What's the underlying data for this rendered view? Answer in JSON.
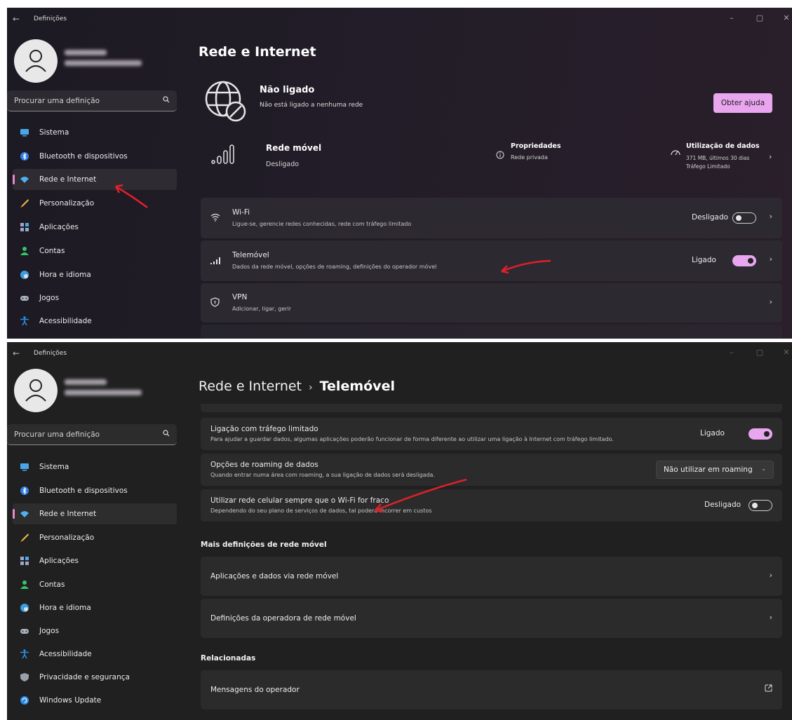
{
  "window": {
    "app_title": "Definições",
    "back_icon": "arrow-left-icon",
    "controls": [
      "minimize-icon",
      "restore-icon",
      "close-icon"
    ]
  },
  "search": {
    "placeholder": "Procurar uma definição",
    "icon": "search-icon"
  },
  "nav": {
    "items": [
      {
        "label": "Sistema",
        "icon": "monitor-icon"
      },
      {
        "label": "Bluetooth e dispositivos",
        "icon": "bluetooth-icon"
      },
      {
        "label": "Rede e Internet",
        "icon": "wifi-icon"
      },
      {
        "label": "Personalização",
        "icon": "brush-icon"
      },
      {
        "label": "Aplicações",
        "icon": "apps-icon"
      },
      {
        "label": "Contas",
        "icon": "person-icon"
      },
      {
        "label": "Hora e idioma",
        "icon": "globe-clock-icon"
      },
      {
        "label": "Jogos",
        "icon": "gamepad-icon"
      },
      {
        "label": "Acessibilidade",
        "icon": "accessibility-icon"
      },
      {
        "label": "Privacidade e segurança",
        "icon": "shield-icon"
      },
      {
        "label": "Windows Update",
        "icon": "update-icon"
      }
    ]
  },
  "top": {
    "page_title": "Rede e Internet",
    "status": {
      "title": "Não ligado",
      "subtitle": "Não está ligado a nenhuma rede",
      "help_button": "Obter ajuda"
    },
    "mobile": {
      "title": "Rede móvel",
      "subtitle": "Desligado"
    },
    "properties": {
      "title": "Propriedades",
      "subtitle": "Rede privada"
    },
    "data_usage": {
      "title": "Utilização de dados",
      "line1": "371 MB, últimos 30 dias",
      "line2": "Tráfego Limitado"
    },
    "rows": [
      {
        "title": "Wi-Fi",
        "subtitle": "Ligue-se, gerencie redes conhecidas, rede com tráfego limitado",
        "state": "Desligado",
        "on": false
      },
      {
        "title": "Telemóvel",
        "subtitle": "Dados da rede móvel, opções de roaming, definições do operador móvel",
        "state": "Ligado",
        "on": true
      },
      {
        "title": "VPN",
        "subtitle": "Adicionar, ligar, gerir"
      }
    ]
  },
  "bottom": {
    "breadcrumb": {
      "parent": "Rede e Internet",
      "separator": "›",
      "current": "Telemóvel"
    },
    "rows": [
      {
        "title": "Ligação com tráfego limitado",
        "subtitle": "Para ajudar a guardar dados, algumas aplicações poderão funcionar de forma diferente ao utilizar uma ligação à Internet com tráfego limitado.",
        "state": "Ligado",
        "on": true
      },
      {
        "title": "Opções de roaming de dados",
        "subtitle": "Quando entrar numa área com roaming, a sua ligação de dados será desligada.",
        "dropdown": "Não utilizar em roaming"
      },
      {
        "title": "Utilizar rede celular sempre que o Wi-Fi for fraco",
        "subtitle": "Dependendo do seu plano de serviços de dados, tal poderá incorrer em custos",
        "state": "Desligado",
        "on": false
      }
    ],
    "more_section": "Mais definições de rede móvel",
    "more_rows": [
      "Aplicações e dados via rede móvel",
      "Definições da operadora de rede móvel"
    ],
    "related_section": "Relacionadas",
    "related_rows": [
      "Mensagens do operador"
    ],
    "external_icon": "external-link-icon"
  },
  "colors": {
    "accent": "#e8a6ef",
    "annotation": "#e0202a"
  }
}
